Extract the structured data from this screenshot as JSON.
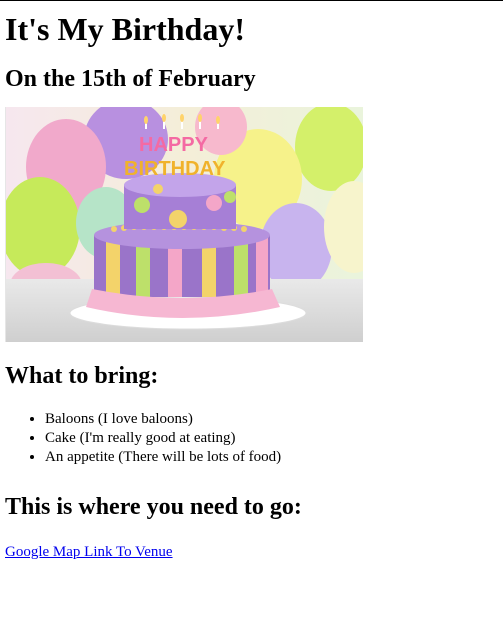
{
  "header": {
    "title": "It's My Birthday!",
    "date_line": "On the 15th of February"
  },
  "image": {
    "name": "birthday-cake",
    "topper_text": [
      "HAPPY",
      "BIRTHDAY"
    ]
  },
  "bring": {
    "heading": "What to bring:",
    "items": [
      "Baloons (I love baloons)",
      "Cake (I'm really good at eating)",
      "An appetite (There will be lots of food)"
    ]
  },
  "location": {
    "heading": "This is where you need to go:",
    "link_text": "Google Map Link To Venue"
  },
  "colors": {
    "link": "#0000ee",
    "text": "#000000",
    "background": "#ffffff"
  }
}
